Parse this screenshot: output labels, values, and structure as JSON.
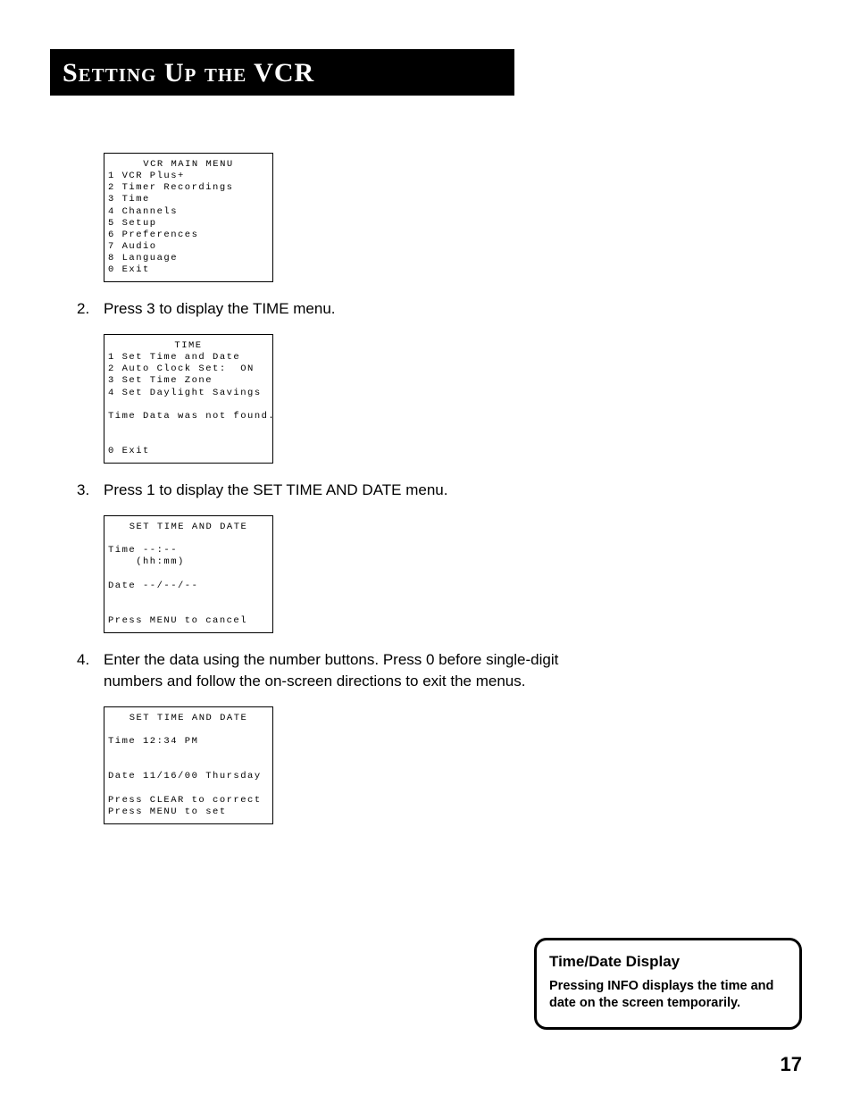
{
  "header": {
    "title": "Setting Up the VCR"
  },
  "screens": {
    "main_menu": {
      "title": "VCR MAIN MENU",
      "items": [
        "1 VCR Plus+",
        "2 Timer Recordings",
        "3 Time",
        "4 Channels",
        "5 Setup",
        "6 Preferences",
        "7 Audio",
        "8 Language",
        "0 Exit"
      ]
    },
    "time_menu": {
      "title": "TIME",
      "items": [
        "1 Set Time and Date",
        "2 Auto Clock Set:  ON",
        "3 Set Time Zone",
        "4 Set Daylight Savings"
      ],
      "status": "Time Data was not found.",
      "exit": "0 Exit"
    },
    "set_time_blank": {
      "title": "SET TIME AND DATE",
      "time_line": "Time --:--",
      "time_hint": "    (hh:mm)",
      "date_line": "Date --/--/--",
      "footer": "Press MENU to cancel"
    },
    "set_time_filled": {
      "title": "SET TIME AND DATE",
      "time_line": "Time 12:34 PM",
      "date_line": "Date 11/16/00 Thursday",
      "footer1": "Press CLEAR to correct",
      "footer2": "Press MENU to set"
    }
  },
  "steps": {
    "s2": {
      "num": "2.",
      "text": "Press 3 to display the TIME menu."
    },
    "s3": {
      "num": "3.",
      "text": "Press 1 to display the SET TIME AND DATE menu."
    },
    "s4": {
      "num": "4.",
      "text": "Enter the data using the number buttons. Press 0 before single-digit numbers and follow the on-screen directions to exit the menus."
    }
  },
  "tip": {
    "title": "Time/Date Display",
    "body": "Pressing INFO displays the time and date on the screen temporarily."
  },
  "page_number": "17"
}
